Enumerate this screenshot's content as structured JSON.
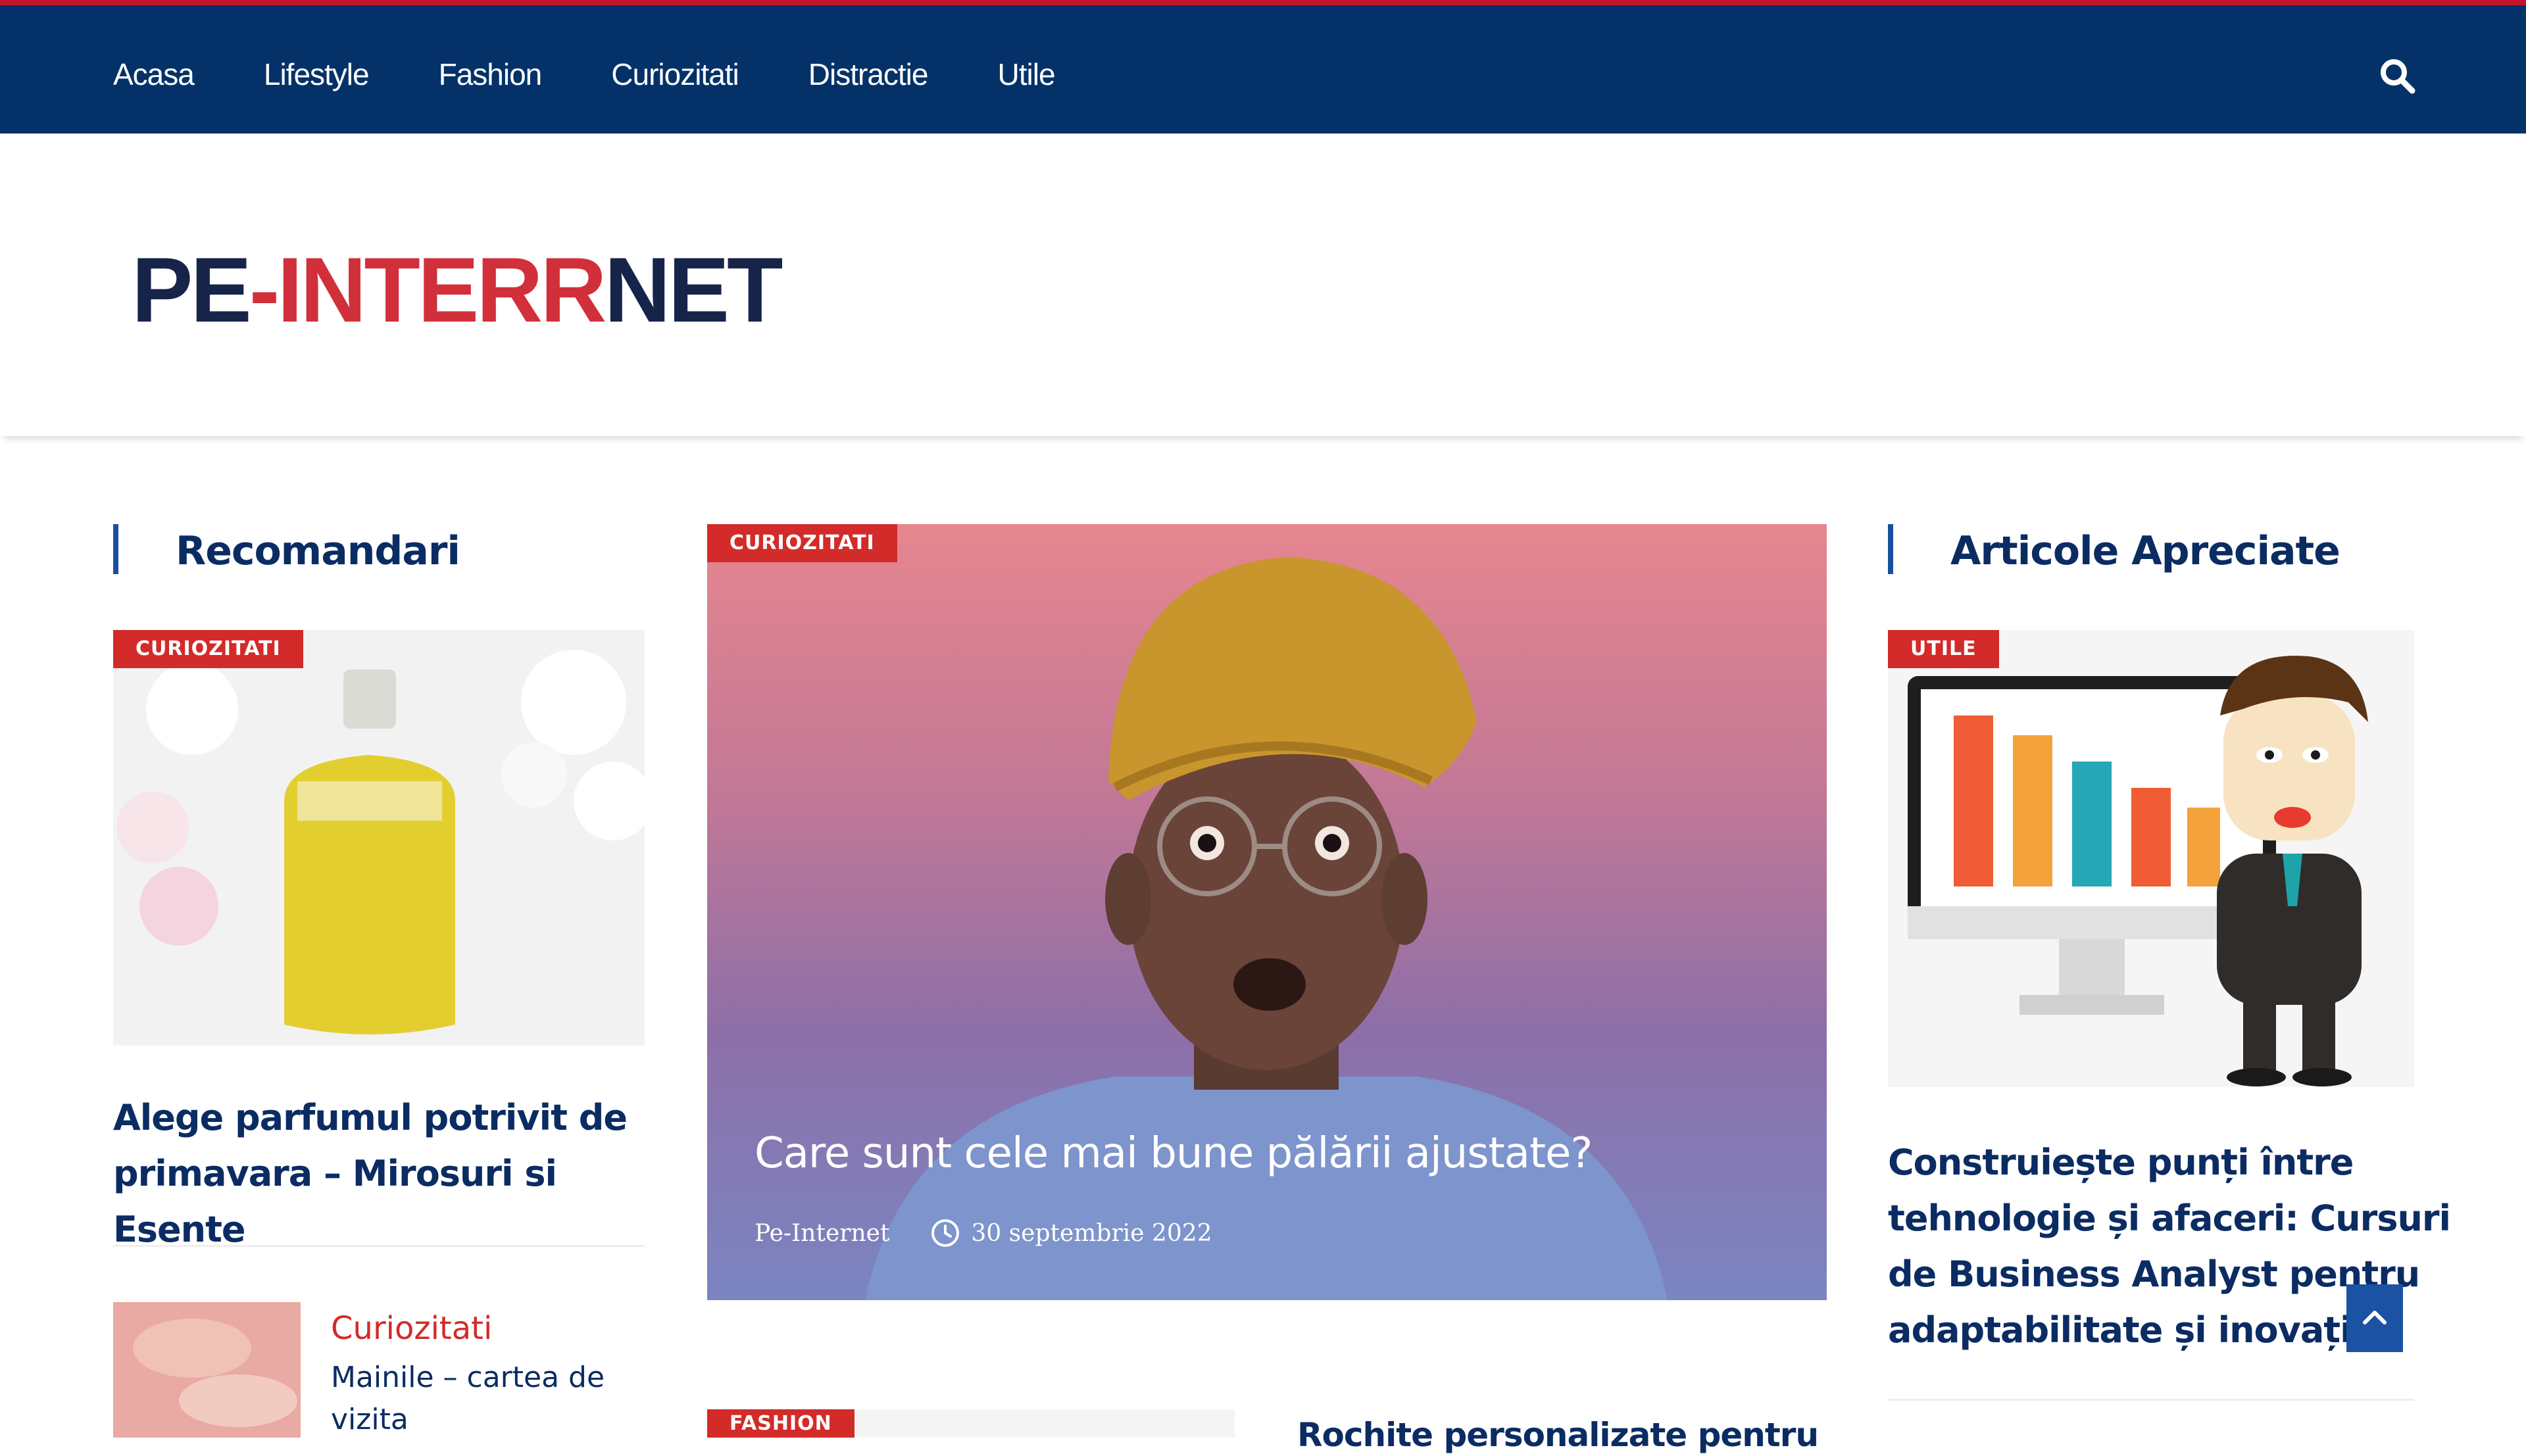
{
  "nav": {
    "items": [
      "Acasa",
      "Lifestyle",
      "Fashion",
      "Curiozitati",
      "Distractie",
      "Utile"
    ],
    "search_icon": "search-icon"
  },
  "header": {
    "logo_part1": "PE",
    "logo_part2": "-INTER",
    "logo_part3": "R",
    "logo_part4": "NET"
  },
  "left": {
    "section_title": "Recomandari",
    "card": {
      "badge": "CURIOZITATI",
      "title": "Alege parfumul potrivit de primavara – Mirosuri si Esente"
    },
    "mini": {
      "category": "Curiozitati",
      "title": "Mainile – cartea de vizita"
    }
  },
  "center": {
    "feature": {
      "badge": "CURIOZITATI",
      "title": "Care sunt cele mai bune pălării ajustate?",
      "author": "Pe-Internet",
      "date": "30 septembrie 2022"
    },
    "second": {
      "badge": "FASHION",
      "title": "Rochite personalizate pentru"
    }
  },
  "right": {
    "section_title": "Articole Apreciate",
    "card": {
      "badge": "UTILE",
      "title": "Construiește punți între tehnologie și afaceri: Cursuri de Business Analyst pentru adaptabilitate și inovație"
    }
  },
  "colors": {
    "nav_bg": "#043268",
    "accent_red": "#d22b29",
    "title_blue": "#0b2c63"
  }
}
